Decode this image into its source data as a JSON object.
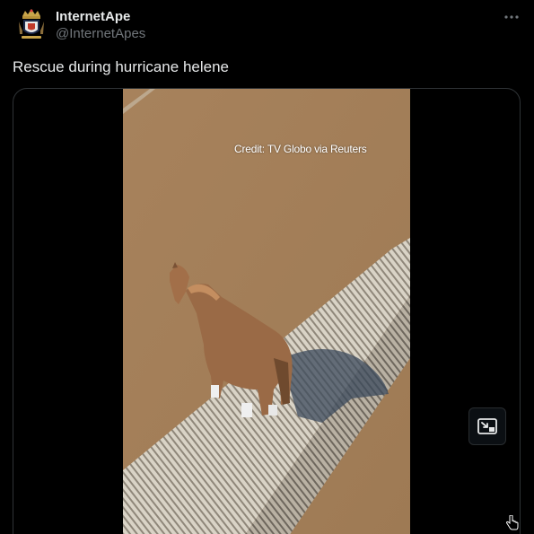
{
  "tweet": {
    "author": {
      "display_name": "InternetApe",
      "handle": "@InternetApes",
      "avatar_icon": "crest-avatar-icon"
    },
    "text": "Rescue during hurricane helene",
    "more_icon": "more-horizontal-icon"
  },
  "media": {
    "type": "video",
    "overlay_credit": "Credit: TV Globo via Reuters",
    "pip_icon": "picture-in-picture-icon"
  },
  "colors": {
    "background": "#000000",
    "text_primary": "#e7e9ea",
    "text_secondary": "#71767b",
    "border": "#2f3336",
    "flood_water": "#a5805a"
  }
}
